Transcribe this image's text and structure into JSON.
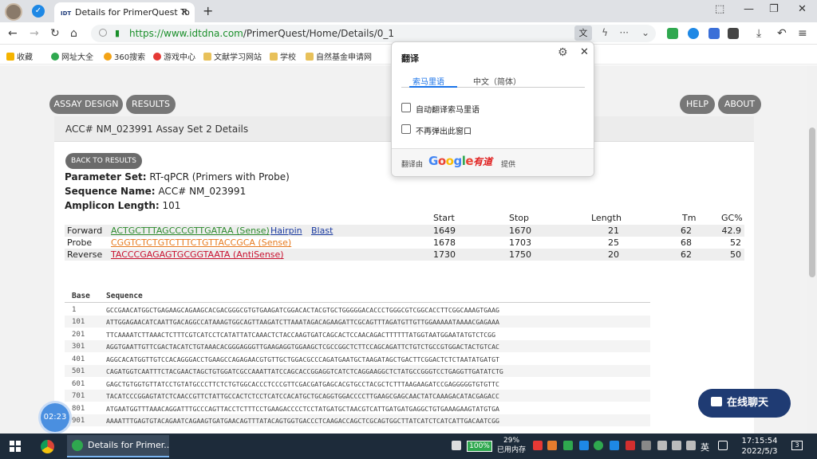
{
  "browser": {
    "tab_title": "Details for PrimerQuest To",
    "tab_favicon": "IDT",
    "url_host": "https://www.idtdna.com",
    "url_path": "/PrimerQuest/Home/Details/0_1"
  },
  "bookmarks": [
    "收藏",
    "网址大全",
    "360搜索",
    "游戏中心",
    "文献学习网站",
    "学校",
    "自然基金申请网"
  ],
  "nav": {
    "assay_design": "ASSAY DESIGN",
    "results": "RESULTS",
    "help": "HELP",
    "about": "ABOUT"
  },
  "card": {
    "header": "ACC# NM_023991 Assay Set 2 Details",
    "back_button": "BACK TO RESULTS",
    "param_label": "Parameter Set:",
    "param_value": "RT-qPCR (Primers with Probe)",
    "seqname_label": "Sequence Name:",
    "seqname_value": "ACC# NM_023991",
    "amplicon_label": "Amplicon Length:",
    "amplicon_value": "101"
  },
  "primer_table": {
    "headers": [
      "Start",
      "Stop",
      "Length",
      "Tm",
      "GC%"
    ],
    "rows": [
      {
        "type": "Forward",
        "seq": "ACTGCTTTAGCCCGTTGATAA (Sense)",
        "hairpin": "Hairpin",
        "blast": "Blast",
        "start": "1649",
        "stop": "1670",
        "length": "21",
        "tm": "62",
        "gc": "42.9"
      },
      {
        "type": "Probe",
        "seq": "CGGTCTCTGTCTTTCTGTTACCGCA (Sense)",
        "start": "1678",
        "stop": "1703",
        "length": "25",
        "tm": "68",
        "gc": "52"
      },
      {
        "type": "Reverse",
        "seq": "TACCCGAGAGTGCGGTAATA (AntiSense)",
        "start": "1730",
        "stop": "1750",
        "length": "20",
        "tm": "62",
        "gc": "50"
      }
    ]
  },
  "sequence_table": {
    "headers": [
      "Base",
      "Sequence"
    ],
    "rows": [
      {
        "base": "1",
        "seq": "GCCGAACATGGCTGAGAAGCAGAAGCACGACGGGCGTGTGAAGATCGGACACTACGTGCTGGGGGACACCCTGGGCGTCGGCACCTTCGGCAAAGTGAAG"
      },
      {
        "base": "101",
        "seq": "ATTGGAGAACATCAATTGACAGGCCATAAAGTGGCAGTTAAGATCTTAAATAGACAGAAGATTCGCAGTTTAGATGTTGTTGGAAAAATAAAACGAGAAA"
      },
      {
        "base": "201",
        "seq": "TTCAAAATCTTAAACTCTTTCGTCATCCTCATATTATCAAACTCTACCAAGTGATCAGCACTCCAACAGACTTTTTTATGGTAATGGAATATGTCTCGG"
      },
      {
        "base": "301",
        "seq": "AGGTGAATTGTTCGACTACATCTGTAAACACGGGAGGGTTGAAGAGGTGGAAGCTCGCCGGCTCTTCCAGCAGATTCTGTCTGCCGTGGACTACTGTCAC"
      },
      {
        "base": "401",
        "seq": "AGGCACATGGTTGTCCACAGGGACCTGAAGCCAGAGAACGTGTTGCTGGACGCCCAGATGAATGCTAAGATAGCTGACTTCGGACTCTCTAATATGATGT"
      },
      {
        "base": "501",
        "seq": "CAGATGGTCAATTTCTACGAACTAGCTGTGGATCGCCAAATTATCCAGCACCGGAGGTCATCTCAGGAAGGCTCTATGCCGGGTCCTGAGGTTGATATCTG"
      },
      {
        "base": "601",
        "seq": "GAGCTGTGGTGTTATCCTGTATGCCCTTCTCTGTGGCACCCTCCCGTTCGACGATGAGCACGTGCCTACGCTCTTTAAGAAGATCCGAGGGGGTGTGTTC"
      },
      {
        "base": "701",
        "seq": "TACATCCCGGAGTATCTCAACCGTTCTATTGCCACTCTCCTCATCCACATGCTGCAGGTGGACCCCTTGAAGCGAGCAACTATCAAAGACATACGAGACC"
      },
      {
        "base": "801",
        "seq": "ATGAATGGTTTAAACAGGATTTGCCCAGTTACCTCTTTCCTGAAGACCCCTCCTATGATGCTAACGTCATTGATGATGAGGCTGTGAAAGAAGTATGTGA"
      },
      {
        "base": "901",
        "seq": "AAAATTTGAGTGTACAGAATCAGAAGTGATGAACAGTTTATACAGTGGTGACCCTCAAGACCAGCTCGCAGTGGCTTATCATCTCATCATTGACAATCGG"
      }
    ]
  },
  "translate_popup": {
    "title": "翻译",
    "tab_source": "索马里语",
    "tab_target": "中文（简体）",
    "option1": "自动翻译索马里语",
    "option2": "不再弹出此窗口",
    "footer_prefix": "翻译由",
    "footer_google": "Google",
    "footer_youdao": "有道",
    "footer_suffix": "提供"
  },
  "chat_button": "在线聊天",
  "timer": "02:23",
  "taskbar": {
    "app_label": "Details for Primer...",
    "battery": "100%",
    "mem_percent": "29%",
    "mem_label": "已用内存",
    "lang": "英",
    "time": "17:15:54",
    "date": "2022/5/3"
  }
}
